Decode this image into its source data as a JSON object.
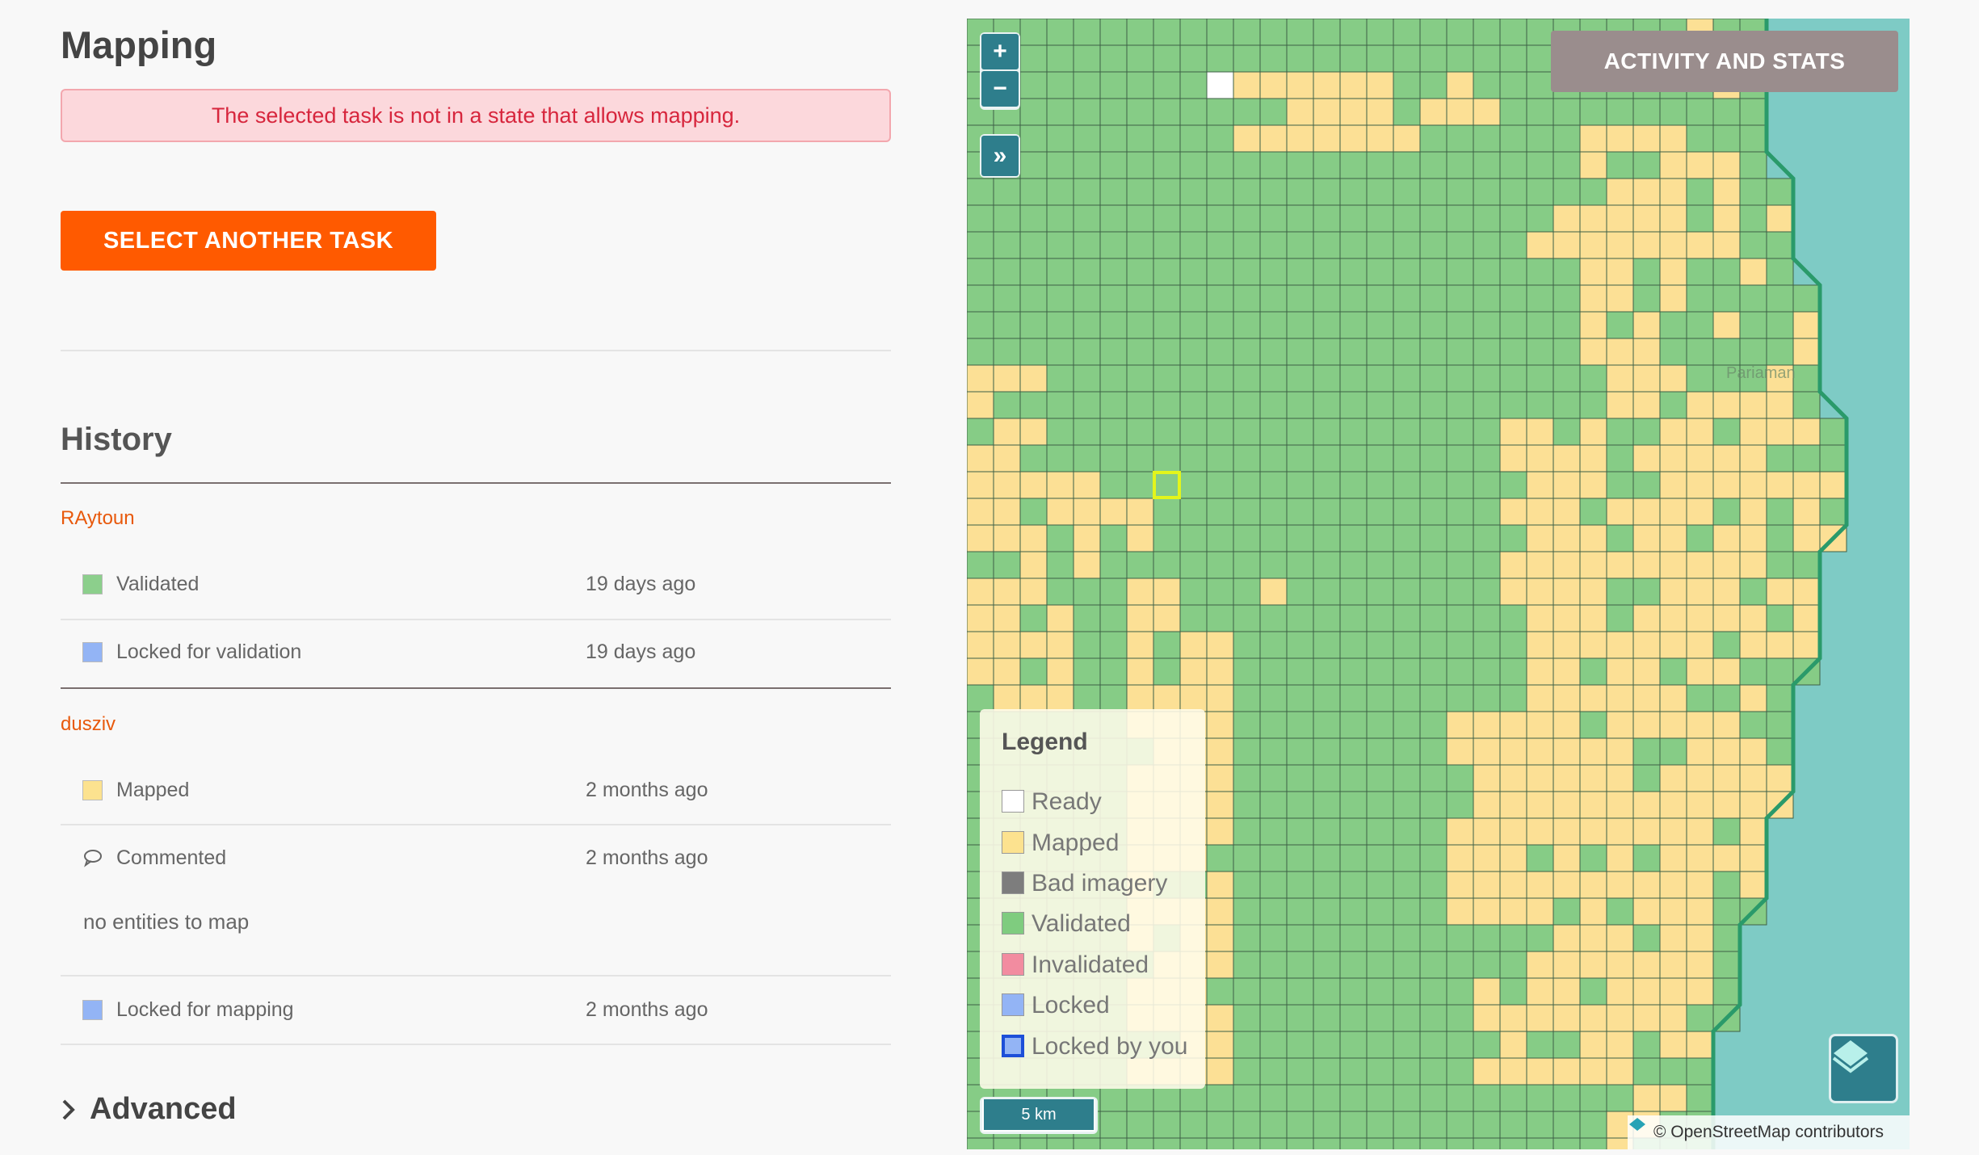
{
  "page": {
    "title": "Mapping"
  },
  "alert": {
    "message": "The selected task is not in a state that allows mapping."
  },
  "actions": {
    "select_another": "SELECT ANOTHER TASK"
  },
  "history": {
    "title": "History",
    "groups": [
      {
        "user": "RAytoun",
        "entries": [
          {
            "action": "Validated",
            "time": "19 days ago",
            "color": "#8ccf8c"
          },
          {
            "action": "Locked for validation",
            "time": "19 days ago",
            "color": "#93b4f5"
          }
        ]
      },
      {
        "user": "dusziv",
        "entries": [
          {
            "action": "Mapped",
            "time": "2 months ago",
            "color": "#fce28f"
          },
          {
            "action": "Commented",
            "time": "2 months ago",
            "comment": "no entities to map"
          },
          {
            "action": "Locked for mapping",
            "time": "2 months ago",
            "color": "#93b4f5"
          }
        ]
      }
    ]
  },
  "advanced": {
    "label": "Advanced"
  },
  "map": {
    "zoom_in": "+",
    "zoom_out": "−",
    "expand": "»",
    "activity_button": "ACTIVITY AND STATS",
    "place_label": "Pariaman",
    "scale": "5 km",
    "attribution": "© OpenStreetMap contributors",
    "legend": {
      "title": "Legend",
      "items": [
        {
          "label": "Ready",
          "color": "#ffffff"
        },
        {
          "label": "Mapped",
          "color": "#fce28f"
        },
        {
          "label": "Bad imagery",
          "color": "#7d7d7d"
        },
        {
          "label": "Validated",
          "color": "#7fcc7f"
        },
        {
          "label": "Invalidated",
          "color": "#f28ca0"
        },
        {
          "label": "Locked",
          "color": "#93b4f5"
        },
        {
          "label": "Locked by you",
          "color": "#93b4f5",
          "border": "#1d4fd8"
        }
      ]
    },
    "colors": {
      "validated": "#86cc86",
      "mapped": "#fce095",
      "ready": "#ffffff",
      "sea": "#7ecbc5",
      "grid": "#3d5f46",
      "selected": "#e3f51b"
    }
  }
}
